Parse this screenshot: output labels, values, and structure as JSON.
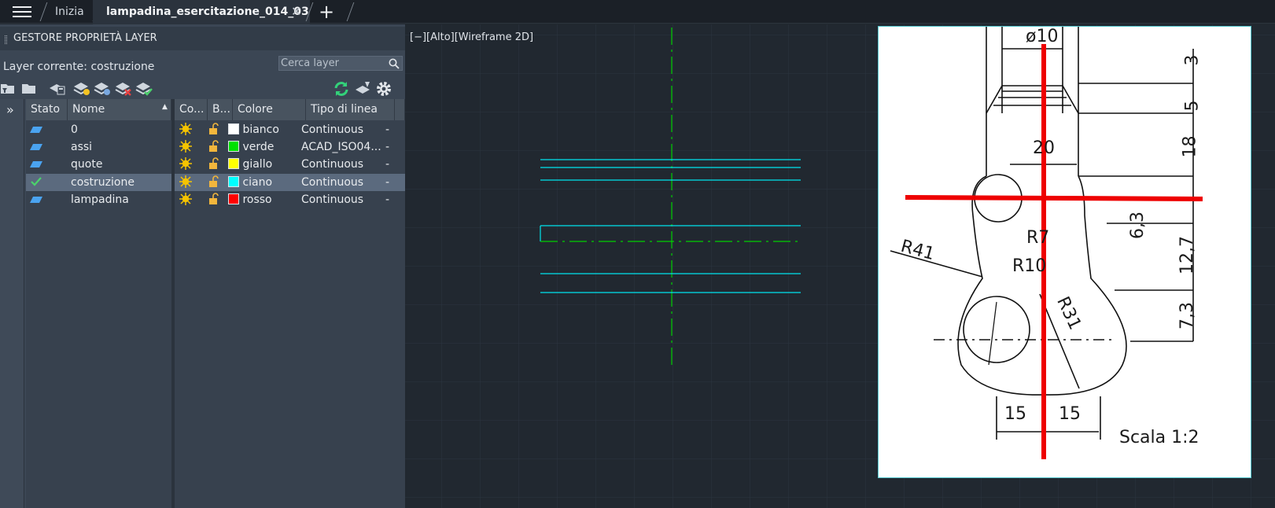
{
  "tabs": {
    "menu_icon": "hamburger-menu-icon",
    "home": "Inizia",
    "active": "lampadina_esercitazione_014_03",
    "close_glyph": "✕",
    "new_glyph": "+"
  },
  "panel": {
    "title": "GESTORE PROPRIETÀ LAYER",
    "current_layer": "Layer corrente: costruzione",
    "search_placeholder": "Cerca layer",
    "expand_glyph": "»",
    "headers": {
      "stato": "Stato",
      "nome": "Nome",
      "co": "Co...",
      "b": "B...",
      "colore": "Colore",
      "tipo": "Tipo di linea"
    },
    "layers": [
      {
        "name": "0",
        "color_name": "bianco",
        "color": "#ffffff",
        "linetype": "Continuous",
        "current": false
      },
      {
        "name": "assi",
        "color_name": "verde",
        "color": "#00e000",
        "linetype": "ACAD_ISO04...",
        "current": false
      },
      {
        "name": "quote",
        "color_name": "giallo",
        "color": "#ffff00",
        "linetype": "Continuous",
        "current": false
      },
      {
        "name": "costruzione",
        "color_name": "ciano",
        "color": "#00ffff",
        "linetype": "Continuous",
        "current": true
      },
      {
        "name": "lampadina",
        "color_name": "rosso",
        "color": "#ff0000",
        "linetype": "Continuous",
        "current": false
      }
    ]
  },
  "viewport": {
    "label": "[−][Alto][Wireframe 2D]"
  },
  "reference_image": {
    "dims": [
      "ø10",
      "3",
      "5",
      "18",
      "20",
      "R7",
      "6,3",
      "12,7",
      "R41",
      "R10",
      "R31",
      "7,3",
      "15",
      "15"
    ],
    "scale_text": "Scala  1:2"
  },
  "colors": {
    "accent_cyan": "#00e5ee",
    "axis_green": "#00d000",
    "red": "#ee0000"
  }
}
